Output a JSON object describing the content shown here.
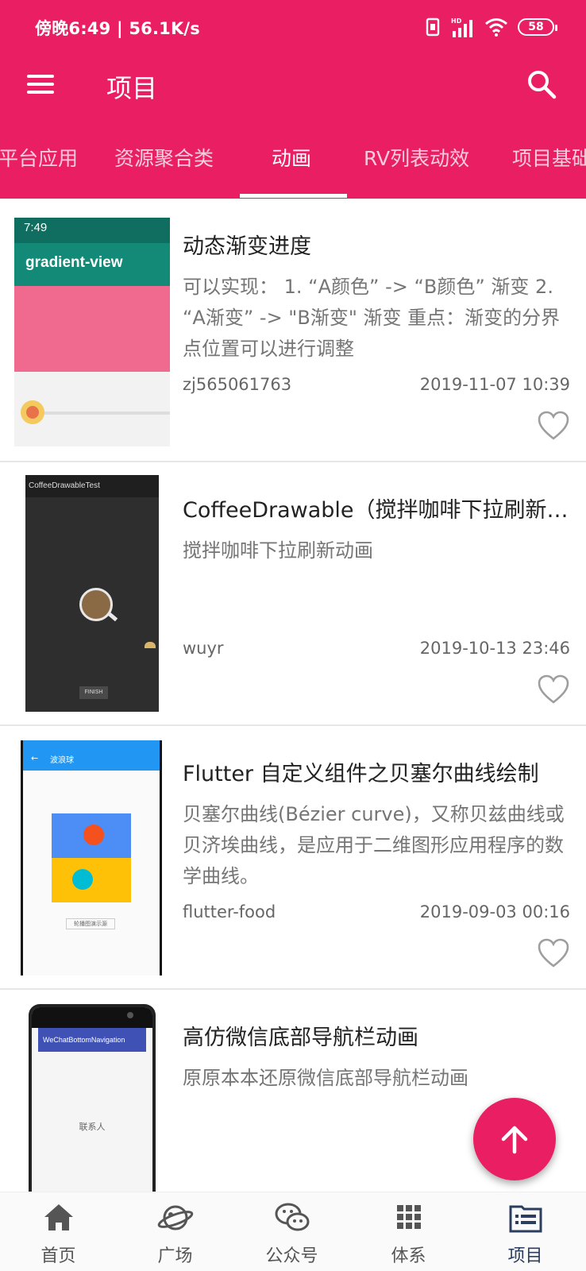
{
  "status_bar": {
    "left_text": "傍晚6:49 | 56.1K/s",
    "battery": "58"
  },
  "toolbar": {
    "title": "项目"
  },
  "tabs": [
    {
      "label": "平台应用"
    },
    {
      "label": "资源聚合类"
    },
    {
      "label": "动画",
      "active": true
    },
    {
      "label": "RV列表动效"
    },
    {
      "label": "项目基础"
    }
  ],
  "articles": [
    {
      "title": "动态渐变进度",
      "desc": "可以实现： 1. “A颜色” -> “B颜色” 渐变 2. “A渐变” -> \"B渐变\" 渐变 重点：渐变的分界点位置可以进行调整",
      "author": "zj565061763",
      "date": "2019-11-07 10:39",
      "thumb": {
        "time": "7:49",
        "title": "gradient-view"
      }
    },
    {
      "title": "CoffeeDrawable（搅拌咖啡下拉刷新动画）",
      "desc": "搅拌咖啡下拉刷新动画",
      "author": "wuyr",
      "date": "2019-10-13 23:46",
      "thumb": {
        "title": "CoffeeDrawableTest",
        "button": "FINISH"
      }
    },
    {
      "title": "Flutter 自定义组件之贝塞尔曲线绘制",
      "desc": "贝塞尔曲线(Bézier curve)，又称贝兹曲线或贝济埃曲线，是应用于二维图形应用程序的数学曲线。",
      "author": "flutter-food",
      "date": "2019-09-03 00:16",
      "thumb": {
        "title": "波浪球",
        "button": "轮播图演示源"
      }
    },
    {
      "title": "高仿微信底部导航栏动画",
      "desc": "原原本本还原微信底部导航栏动画",
      "author": "",
      "date": "",
      "thumb": {
        "title": "WeChatBottomNavigation",
        "center": "联系人"
      }
    }
  ],
  "bottom_nav": [
    {
      "label": "首页",
      "icon": "home-icon"
    },
    {
      "label": "广场",
      "icon": "planet-icon"
    },
    {
      "label": "公众号",
      "icon": "wechat-icon"
    },
    {
      "label": "体系",
      "icon": "grid-icon"
    },
    {
      "label": "项目",
      "icon": "list-icon",
      "active": true
    }
  ],
  "colors": {
    "primary": "#e91e63",
    "nav_active": "#2c3e60"
  }
}
